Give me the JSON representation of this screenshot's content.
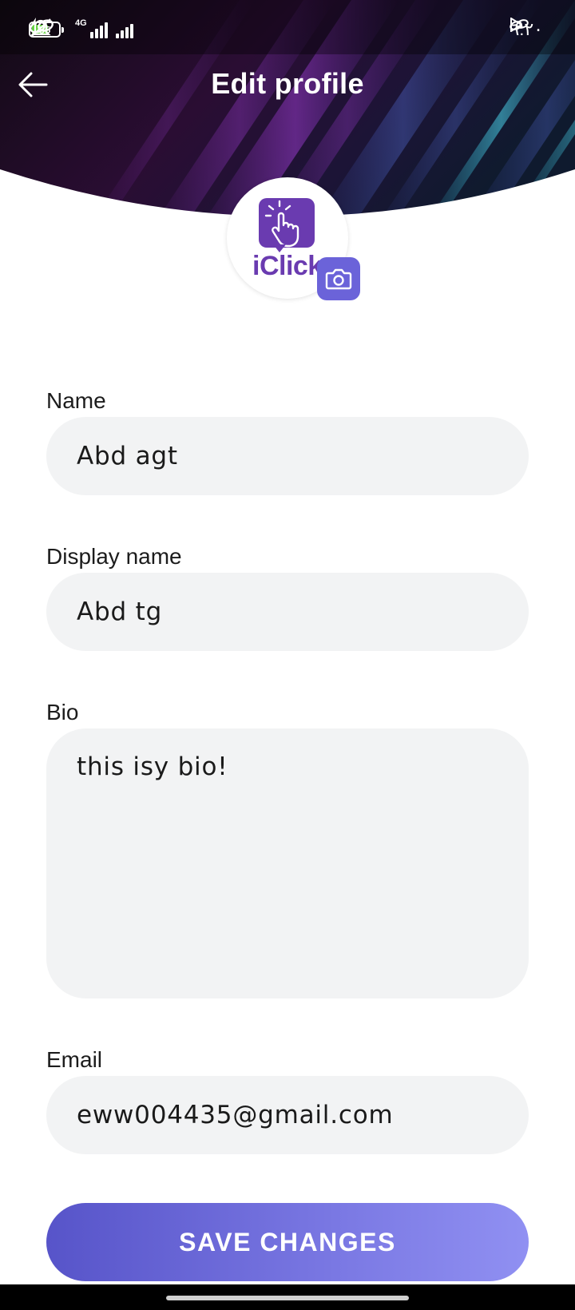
{
  "status_bar": {
    "battery_level": "55",
    "network_label": "4G",
    "time": "٦:٢٠"
  },
  "header": {
    "title": "Edit profile",
    "back_icon": "arrow-left-icon"
  },
  "avatar": {
    "logo_text": "iClick",
    "camera_icon": "camera-icon"
  },
  "form": {
    "name": {
      "label": "Name",
      "value": "Abd agt"
    },
    "display_name": {
      "label": "Display name",
      "value": "Abd tg"
    },
    "bio": {
      "label": "Bio",
      "value": "this isy bio!"
    },
    "email": {
      "label": "Email",
      "value": "eww004435@gmail.com"
    }
  },
  "save_button": {
    "label": "SAVE CHANGES"
  },
  "colors": {
    "accent": "#6b63d9",
    "logo_purple": "#6a3bb0",
    "field_bg": "#f2f3f4",
    "header_dark": "#1a0f20"
  }
}
